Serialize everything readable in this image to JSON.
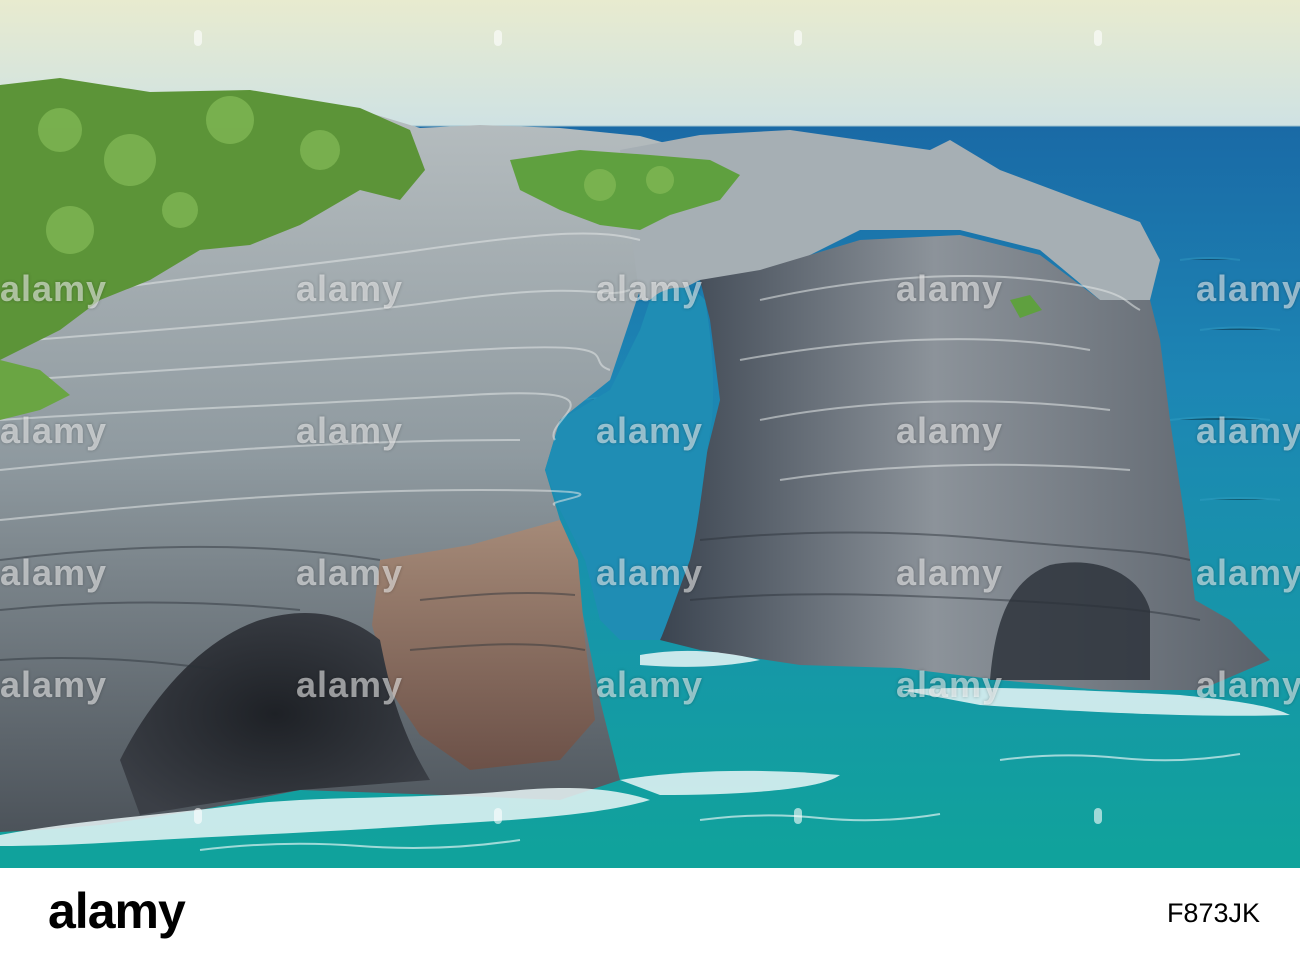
{
  "image": {
    "description_colors": {
      "sky_top": "#e9ecd2",
      "sky_bottom": "#c9dfe4",
      "sea_far": "#1d6fa8",
      "sea_mid": "#1f8fb6",
      "sea_near": "#139a9a",
      "rock_light": "#a9b2b8",
      "rock_dark": "#3e4650",
      "rock_warm": "#8a6a5a",
      "vegetation": "#5f9a3a",
      "foam": "#eaf6f8"
    }
  },
  "watermark": {
    "text": "alamy",
    "icon": "alamy-watermark-icon"
  },
  "footer": {
    "logo": "alamy",
    "image_id": "F873JK"
  }
}
